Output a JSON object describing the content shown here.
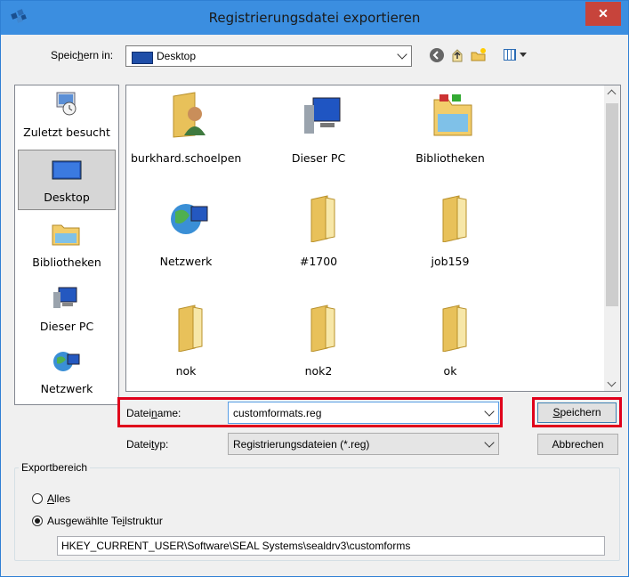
{
  "window": {
    "title": "Registrierungsdatei exportieren",
    "close_glyph": "✕"
  },
  "save_in": {
    "label_pre": "Speic",
    "label_u": "h",
    "label_post": "ern in:",
    "value": "Desktop"
  },
  "places": [
    {
      "label": "Zuletzt besucht",
      "icon": "recent-icon"
    },
    {
      "label": "Desktop",
      "icon": "desktop-icon",
      "selected": true
    },
    {
      "label": "Bibliotheken",
      "icon": "libraries-icon"
    },
    {
      "label": "Dieser PC",
      "icon": "computer-icon"
    },
    {
      "label": "Netzwerk",
      "icon": "network-icon"
    }
  ],
  "files": [
    {
      "label": "burkhard.schoelpen",
      "icon": "user-folder-icon"
    },
    {
      "label": "Dieser PC",
      "icon": "computer-icon"
    },
    {
      "label": "Bibliotheken",
      "icon": "libraries-icon"
    },
    {
      "label": "Netzwerk",
      "icon": "network-icon"
    },
    {
      "label": "#1700",
      "icon": "folder-icon"
    },
    {
      "label": "job159",
      "icon": "folder-icon"
    },
    {
      "label": "nok",
      "icon": "folder-icon"
    },
    {
      "label": "nok2",
      "icon": "folder-icon"
    },
    {
      "label": "ok",
      "icon": "folder-icon"
    }
  ],
  "filename": {
    "label_pre": "Datei",
    "label_u": "n",
    "label_post": "ame:",
    "value": "customformats.reg"
  },
  "filetype": {
    "label_pre": "Datei",
    "label_u": "t",
    "label_post": "yp:",
    "value": "Registrierungsdateien (*.reg)"
  },
  "buttons": {
    "save_u": "S",
    "save_rest": "peichern",
    "cancel": "Abbrechen"
  },
  "export_range": {
    "title": "Exportbereich",
    "all_u": "A",
    "all_rest": "lles",
    "subtree_pre": "Ausgewählte Te",
    "subtree_u": "i",
    "subtree_post": "lstruktur",
    "selected": "subtree",
    "path": "HKEY_CURRENT_USER\\Software\\SEAL Systems\\sealdrv3\\customforms"
  },
  "colors": {
    "titlebar": "#3b8ee0",
    "close": "#c7443b",
    "highlight": "#e0001b"
  }
}
